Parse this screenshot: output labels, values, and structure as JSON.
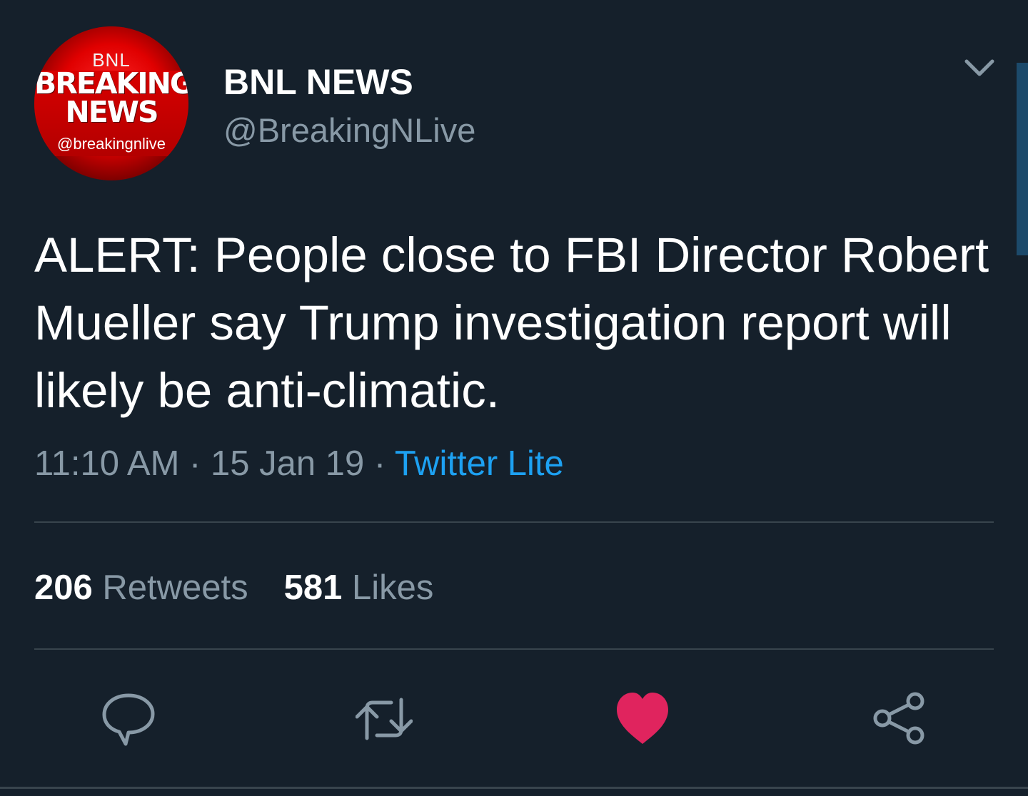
{
  "tweet": {
    "author": {
      "name": "BNL NEWS",
      "handle": "@BreakingNLive",
      "avatar": {
        "top_text": "BNL",
        "main_text_line1": "BREAKING",
        "main_text_line2": "NEWS",
        "handle_text": "@breakingnlive"
      }
    },
    "text": "ALERT: People close to FBI Director Robert Mueller say Trump investigation report will likely be anti-climatic.",
    "meta": {
      "time": "11:10 AM",
      "sep1": " · ",
      "date": "15 Jan 19",
      "sep2": " · ",
      "source": "Twitter Lite"
    },
    "stats": {
      "retweets_count": "206",
      "retweets_label": "Retweets",
      "likes_count": "581",
      "likes_label": "Likes"
    },
    "actions": [
      {
        "name": "reply",
        "icon": "reply-icon"
      },
      {
        "name": "retweet",
        "icon": "retweet-icon"
      },
      {
        "name": "like",
        "icon": "heart-icon",
        "active": true
      },
      {
        "name": "share",
        "icon": "share-icon"
      }
    ]
  },
  "colors": {
    "background": "#15202b",
    "text_secondary": "#8899a6",
    "accent": "#1da1f2",
    "like": "#e0245e",
    "divider": "#38444d"
  }
}
